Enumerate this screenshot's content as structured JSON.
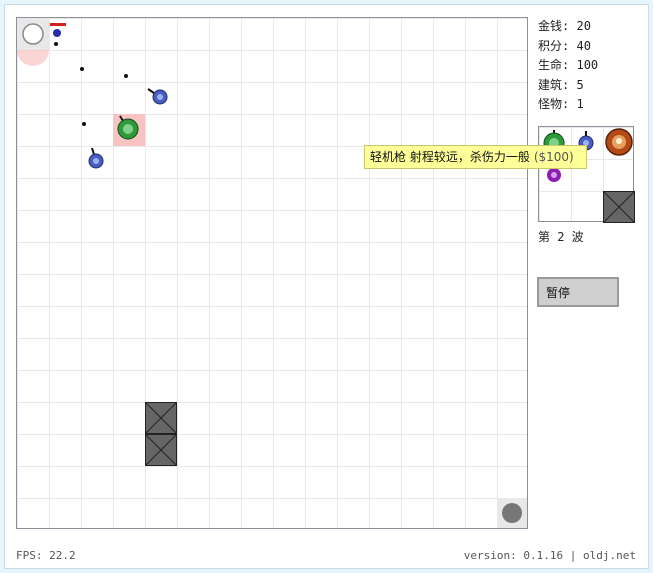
{
  "stats": [
    {
      "label": "金钱:",
      "value": "20"
    },
    {
      "label": "积分:",
      "value": "40"
    },
    {
      "label": "生命:",
      "value": "100"
    },
    {
      "label": "建筑:",
      "value": "5"
    },
    {
      "label": "怪物:",
      "value": "1"
    }
  ],
  "shop": {
    "tooltip_text": "轻机枪 射程较远，杀伤力一般",
    "tooltip_price": "($100)"
  },
  "wave": {
    "text": "第 2 波"
  },
  "controls": {
    "pause_label": "暂停"
  },
  "status": {
    "fps": "FPS: 22.2"
  },
  "footer": {
    "version": "version: 0.1.16",
    "separator": "|",
    "site": "oldj.net"
  },
  "colors": {
    "background": "#e6f4fb",
    "tooltip": "#ffff99",
    "selected_tile": "#f7c3c3",
    "wall": "#666666",
    "light_gun": "#4a5fc2",
    "cannon": "#2e9a3a",
    "laser": "#b24b16",
    "monster": "#8a1fb0"
  },
  "icons": [
    "entrance-circle-icon",
    "exit-circle-icon",
    "monster-icon",
    "light-gun-icon",
    "cannon-icon",
    "laser-tower-icon",
    "wall-block-icon"
  ]
}
